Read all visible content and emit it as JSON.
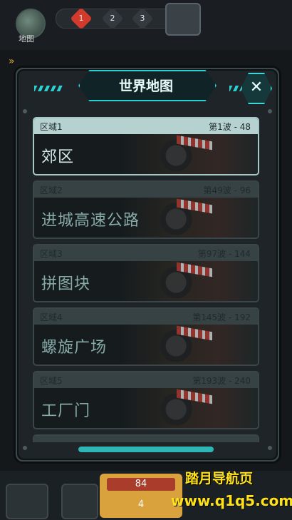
{
  "hud": {
    "map_label": "地图",
    "stages": [
      "1",
      "2",
      "3"
    ],
    "active_stage": 0
  },
  "dialog": {
    "title": "世界地图",
    "close_icon": "close-icon",
    "regions": [
      {
        "code": "区域1",
        "waves": "第1波 - 48",
        "name": "郊区",
        "active": true
      },
      {
        "code": "区域2",
        "waves": "第49波 - 96",
        "name": "进城高速公路",
        "active": false
      },
      {
        "code": "区域3",
        "waves": "第97波 - 144",
        "name": "拼图块",
        "active": false
      },
      {
        "code": "区域4",
        "waves": "第145波 - 192",
        "name": "螺旋广场",
        "active": false
      },
      {
        "code": "区域5",
        "waves": "第193波 - 240",
        "name": "工厂门",
        "active": false
      }
    ]
  },
  "bottom": {
    "counter_top": "84",
    "counter_bottom": "4"
  },
  "watermark": {
    "line1": "踏月导航页",
    "line2": "www.q1q5.com"
  },
  "colors": {
    "accent": "#2dcfd0",
    "active_stage": "#d23b2b",
    "watermark": "#ffe11a"
  }
}
